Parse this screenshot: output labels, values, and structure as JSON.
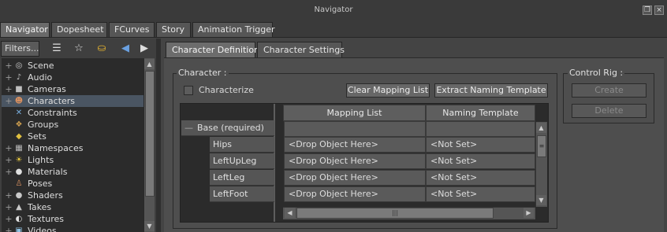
{
  "window": {
    "title": "Navigator"
  },
  "tabs": [
    {
      "label": "Navigator",
      "active": true
    },
    {
      "label": "Dopesheet",
      "active": false
    },
    {
      "label": "FCurves",
      "active": false
    },
    {
      "label": "Story",
      "active": false
    },
    {
      "label": "Animation Trigger",
      "active": false
    }
  ],
  "toolbar": {
    "filters_label": "Filters..."
  },
  "tree": {
    "items": [
      {
        "label": "Scene",
        "icon": "scene-icon",
        "selected": false
      },
      {
        "label": "Audio",
        "icon": "audio-icon",
        "selected": false
      },
      {
        "label": "Cameras",
        "icon": "camera-icon",
        "selected": false
      },
      {
        "label": "Characters",
        "icon": "character-icon",
        "selected": true
      },
      {
        "label": "Constraints",
        "icon": "constraint-icon",
        "selected": false
      },
      {
        "label": "Groups",
        "icon": "group-icon",
        "selected": false
      },
      {
        "label": "Sets",
        "icon": "set-icon",
        "selected": false
      },
      {
        "label": "Namespaces",
        "icon": "namespace-icon",
        "selected": false
      },
      {
        "label": "Lights",
        "icon": "light-icon",
        "selected": false
      },
      {
        "label": "Materials",
        "icon": "material-icon",
        "selected": false
      },
      {
        "label": "Poses",
        "icon": "pose-icon",
        "selected": false
      },
      {
        "label": "Shaders",
        "icon": "shader-icon",
        "selected": false
      },
      {
        "label": "Takes",
        "icon": "take-icon",
        "selected": false
      },
      {
        "label": "Textures",
        "icon": "texture-icon",
        "selected": false
      },
      {
        "label": "Videos",
        "icon": "video-icon",
        "selected": false
      }
    ]
  },
  "content_tabs": [
    {
      "label": "Character Definition",
      "active": true
    },
    {
      "label": "Character Settings",
      "active": false
    }
  ],
  "character": {
    "group_label": "Character :",
    "characterize_label": "Characterize",
    "clear_mapping_label": "Clear Mapping List",
    "extract_naming_label": "Extract Naming Template"
  },
  "control_rig": {
    "group_label": "Control Rig :",
    "create_label": "Create",
    "delete_label": "Delete"
  },
  "grid": {
    "columns": [
      "Mapping List",
      "Naming Template"
    ],
    "group_label": "Base (required)",
    "rows": [
      {
        "name": "Hips",
        "mapping": "<Drop Object Here>",
        "naming": "<Not Set>"
      },
      {
        "name": "LeftUpLeg",
        "mapping": "<Drop Object Here>",
        "naming": "<Not Set>"
      },
      {
        "name": "LeftLeg",
        "mapping": "<Drop Object Here>",
        "naming": "<Not Set>"
      },
      {
        "name": "LeftFoot",
        "mapping": "<Drop Object Here>",
        "naming": "<Not Set>"
      }
    ]
  }
}
